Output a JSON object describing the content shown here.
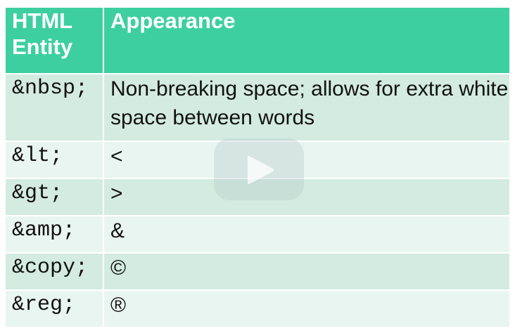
{
  "table": {
    "headers": [
      "HTML Entity",
      "Appearance"
    ],
    "rows": [
      {
        "entity": "&nbsp;",
        "appearance": "Non-breaking space; allows for extra white space between words"
      },
      {
        "entity": "&lt;",
        "appearance": "<"
      },
      {
        "entity": "&gt;",
        "appearance": ">"
      },
      {
        "entity": "&amp;",
        "appearance": "&"
      },
      {
        "entity": "&copy;",
        "appearance": "©"
      },
      {
        "entity": "&reg;",
        "appearance": "®"
      }
    ]
  },
  "colors": {
    "header_bg": "#3ecfa0",
    "row_even_bg": "#d3ebe1",
    "row_odd_bg": "#e9f5f0",
    "header_text": "#ffffff"
  },
  "overlay": {
    "icon": "play-icon"
  }
}
